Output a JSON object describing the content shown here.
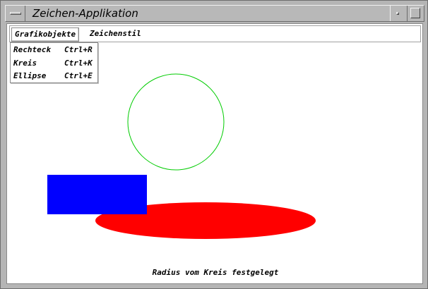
{
  "window": {
    "title": "Zeichen-Applikation"
  },
  "menubar": {
    "items": [
      {
        "label": "Grafikobjekte"
      },
      {
        "label": "Zeichenstil"
      }
    ]
  },
  "dropdown": {
    "items": [
      {
        "label": "Rechteck",
        "accel": "Ctrl+R"
      },
      {
        "label": "Kreis",
        "accel": "Ctrl+K"
      },
      {
        "label": "Ellipse",
        "accel": "Ctrl+E"
      }
    ]
  },
  "canvas": {
    "shapes": [
      {
        "type": "circle",
        "stroke": "#00cc00",
        "fill": "none"
      },
      {
        "type": "ellipse",
        "fill": "#ff0000"
      },
      {
        "type": "rectangle",
        "fill": "#0000ff"
      }
    ]
  },
  "status": {
    "text": "Radius vom Kreis festgelegt"
  }
}
